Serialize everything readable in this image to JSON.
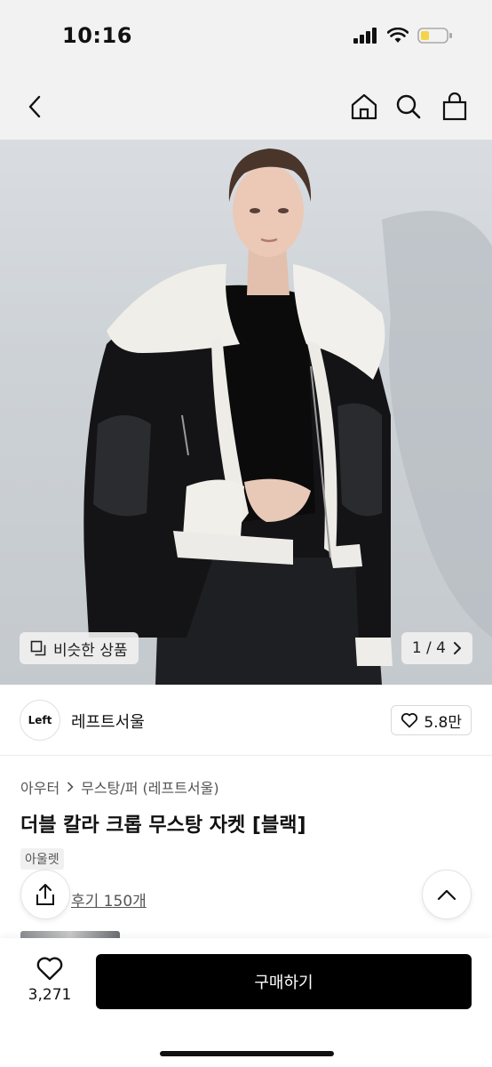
{
  "status_bar": {
    "time": "10:16"
  },
  "header": {
    "back_icon": "chevron-left-icon",
    "home_icon": "home-icon",
    "search_icon": "search-icon",
    "cart_icon": "shopping-bag-icon"
  },
  "hero": {
    "similar_label": "비슷한 상품",
    "pager": "1 / 4"
  },
  "brand": {
    "logo_text": "Left",
    "name": "레프트서울",
    "likes": "5.8만"
  },
  "product": {
    "breadcrumb_1": "아우터",
    "breadcrumb_2": "무스탕/퍼 (레프트서울)",
    "title": "더블 칼라 크롭 무스탕 자켓 [블랙]",
    "badge": "아울렛",
    "review_text": "후기 150개"
  },
  "bottom_bar": {
    "wish_count": "3,271",
    "buy_label": "구매하기"
  },
  "colors": {
    "primary": "#000000",
    "background": "#ffffff",
    "header_bg": "#f2f2f2",
    "battery": "#f5d44a"
  }
}
